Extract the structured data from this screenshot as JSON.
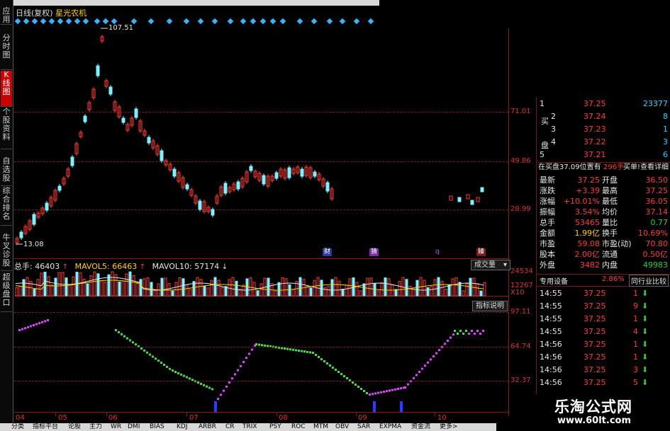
{
  "title": {
    "period": "日线(复权)",
    "stock_name": "星光农机"
  },
  "left_tabs": [
    "应用",
    "分时图",
    "K线图",
    "个股资料",
    "自选股",
    "综合排名",
    "牛叉诊股",
    "超级盘口"
  ],
  "price_pane": {
    "high_label": "107.51",
    "low_label": "13.08",
    "axis_ticks": [
      "71.01",
      "49.86",
      "28.99"
    ],
    "events": [
      {
        "text": "财",
        "color": "#3a5cff"
      },
      {
        "text": "猜",
        "color": "#c050ff"
      },
      {
        "text": "q",
        "color": "#c050ff"
      },
      {
        "text": "臻",
        "color": "#ff5050"
      }
    ]
  },
  "volume_pane": {
    "total_label": "总手: 46403",
    "ma5_label": "MAVOL5: 66463",
    "ma10_label": "MAVOL10: 57174",
    "button": "成交量",
    "axis_ticks": [
      "24534",
      "12267",
      "X10"
    ]
  },
  "indicator_pane": {
    "button": "指标说明",
    "axis_ticks": [
      "97.11",
      "64.74",
      "32.37"
    ]
  },
  "x_axis": [
    "04",
    "05",
    "06",
    "07",
    "08",
    "09",
    "10"
  ],
  "order_book": [
    {
      "side": "",
      "level": "1",
      "price": "37.25",
      "vol": "23377"
    },
    {
      "side": "买",
      "level": "2",
      "price": "37.24",
      "vol": "8"
    },
    {
      "side": "",
      "level": "3",
      "price": "37.23",
      "vol": "1"
    },
    {
      "side": "盘",
      "level": "4",
      "price": "37.22",
      "vol": "3"
    },
    {
      "side": "",
      "level": "5",
      "price": "37.21",
      "vol": "6"
    }
  ],
  "bid_info": {
    "left": "在买盘37.09位置有",
    "mid": "296手",
    "right": "买单!查看详细"
  },
  "stats": [
    {
      "l1": "最新",
      "v1": "37.25",
      "l2": "开盘",
      "v2": "36.50"
    },
    {
      "l1": "涨跌",
      "v1": "+3.39",
      "l2": "最高",
      "v2": "37.25"
    },
    {
      "l1": "涨幅",
      "v1": "+10.01%",
      "l2": "最低",
      "v2": "36.05"
    },
    {
      "l1": "振幅",
      "v1": "3.54%",
      "l2": "均价",
      "v2": "37.14"
    },
    {
      "l1": "总手",
      "v1": "53465",
      "l2": "量比",
      "v2": "0.77"
    },
    {
      "l1": "金额",
      "v1": "1.99亿",
      "l2": "换手",
      "v2": "10.69%"
    },
    {
      "l1": "市盈",
      "v1": "59.08",
      "l2": "市盈(动)",
      "v2": "70.80"
    },
    {
      "l1": "股本",
      "v1": "2.00亿",
      "l2": "流通",
      "v2": "0.50亿"
    },
    {
      "l1": "外盘",
      "v1": "3482",
      "l2": "内盘",
      "v2": "49983"
    }
  ],
  "sector": {
    "name": "专用设备",
    "change": "2.86%",
    "compare": "同行业比较"
  },
  "ticks": [
    {
      "time": "14:55",
      "price": "37.25",
      "vol": "1"
    },
    {
      "time": "14:55",
      "price": "37.25",
      "vol": "9"
    },
    {
      "time": "14:55",
      "price": "37.25",
      "vol": "1"
    },
    {
      "time": "14:55",
      "price": "37.25",
      "vol": "4"
    },
    {
      "time": "14:56",
      "price": "37.25",
      "vol": "1"
    },
    {
      "time": "14:56",
      "price": "37.25",
      "vol": "1"
    },
    {
      "time": "14:56",
      "price": "37.25",
      "vol": "3"
    },
    {
      "time": "14:56",
      "price": "37.25",
      "vol": "5"
    }
  ],
  "watermark": {
    "cn": "乐淘公式网",
    "url": "www.60lt.com"
  },
  "bottom_tabs": [
    "分类",
    "指标平台",
    "论股",
    "主力",
    "WR",
    "DMI",
    "BIAS",
    "KDJ",
    "ARBR",
    "CR",
    "TRIX",
    "PSY",
    "ROC",
    "MTM",
    "OBV",
    "SAR",
    "EXPMA",
    "资金流",
    "更多>"
  ]
}
